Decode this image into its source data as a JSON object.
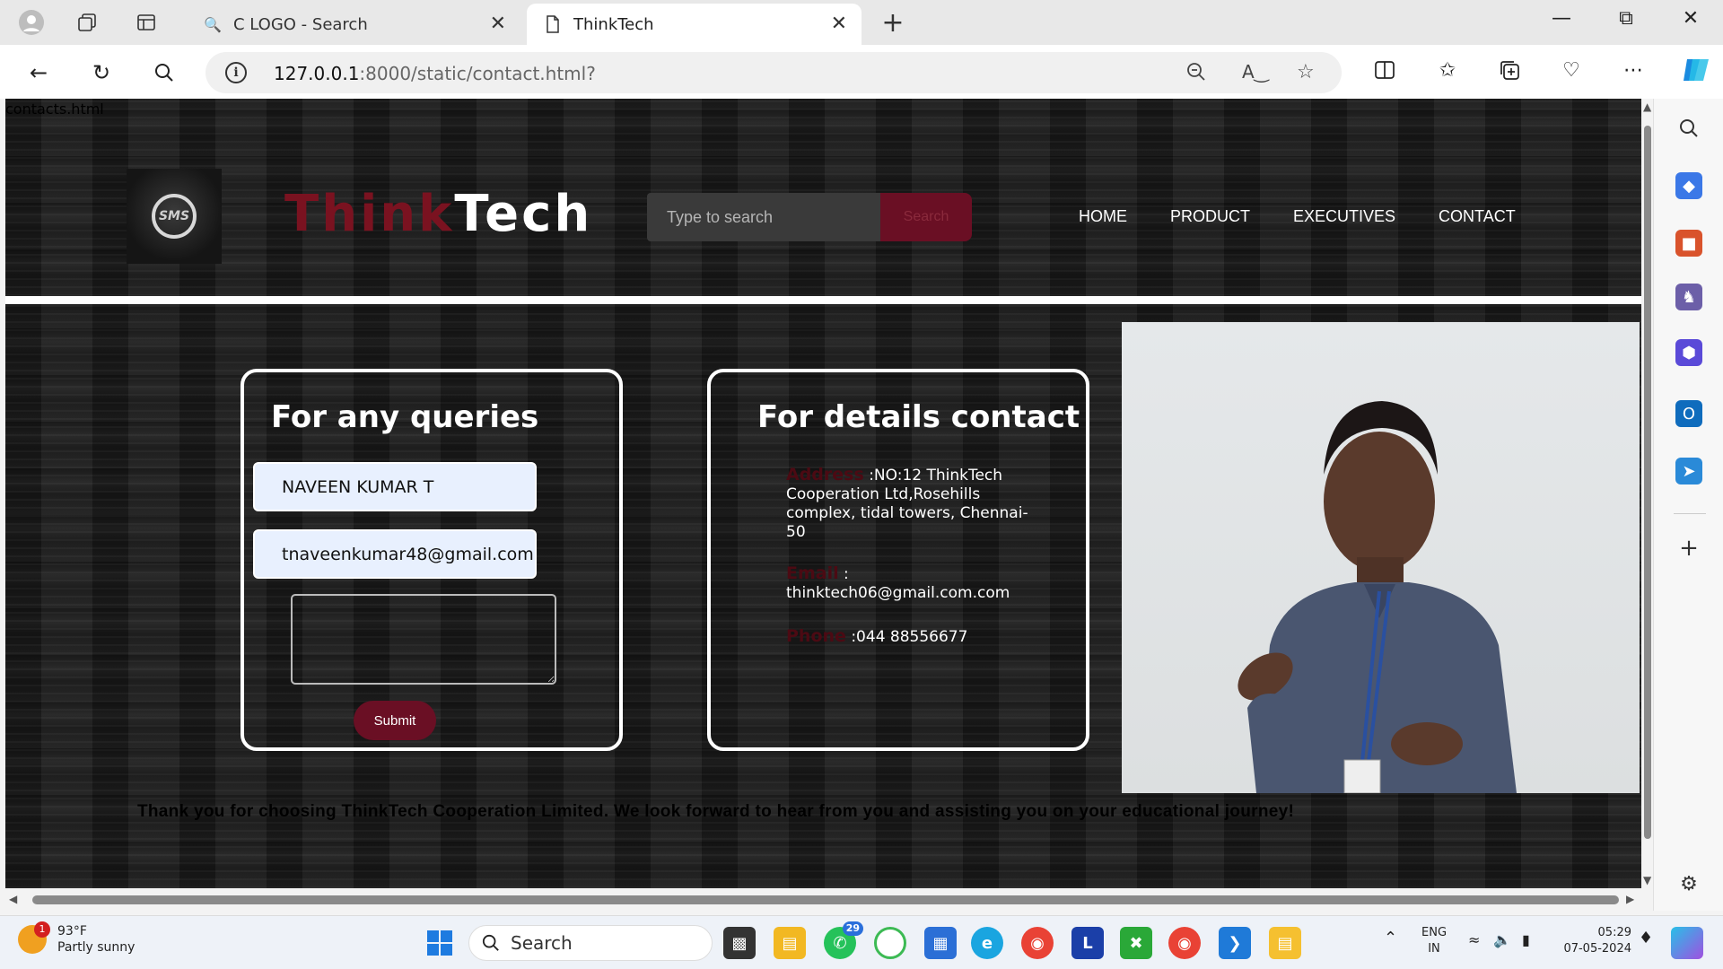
{
  "browser": {
    "tabs": [
      {
        "title": "C LOGO - Search",
        "active": false
      },
      {
        "title": "ThinkTech",
        "active": true
      }
    ],
    "url_host": "127.0.0.1",
    "url_path": ":8000/static/contact.html?"
  },
  "page": {
    "filename": "contacts.html",
    "brand_part1": "Think",
    "brand_part2": "Tech",
    "search_placeholder": "Type to search",
    "search_button": "Search",
    "nav": [
      "HOME",
      "PRODUCT",
      "EXECUTIVES",
      "CONTACT"
    ],
    "queries_card": {
      "title": "For any queries",
      "name_value": "NAVEEN KUMAR T",
      "email_value": "tnaveenkumar48@gmail.com",
      "message_value": "",
      "submit_label": "Submit"
    },
    "contact_card": {
      "title": "For details contact",
      "address_label": "Address",
      "address_value": ":NO:12 ThinkTech Cooperation Ltd,Rosehills complex, tidal towers, Chennai-50",
      "email_label": "Email",
      "email_value": ": thinktech06@gmail.com.com",
      "phone_label": "Phone",
      "phone_value": ":044 88556677"
    },
    "footer": "Thank you for choosing ThinkTech Cooperation Limited. We look forward to hear from you and assisting you on your educational journey!"
  },
  "taskbar": {
    "weather_temp": "93°F",
    "weather_desc": "Partly sunny",
    "weather_badge": "1",
    "search_label": "Search",
    "whatsapp_badge": "29",
    "lang_top": "ENG",
    "lang_bottom": "IN",
    "time": "05:29",
    "date": "07-05-2024"
  },
  "colors": {
    "brand_accent": "#7a1220",
    "button_maroon": "#6a0f24"
  }
}
